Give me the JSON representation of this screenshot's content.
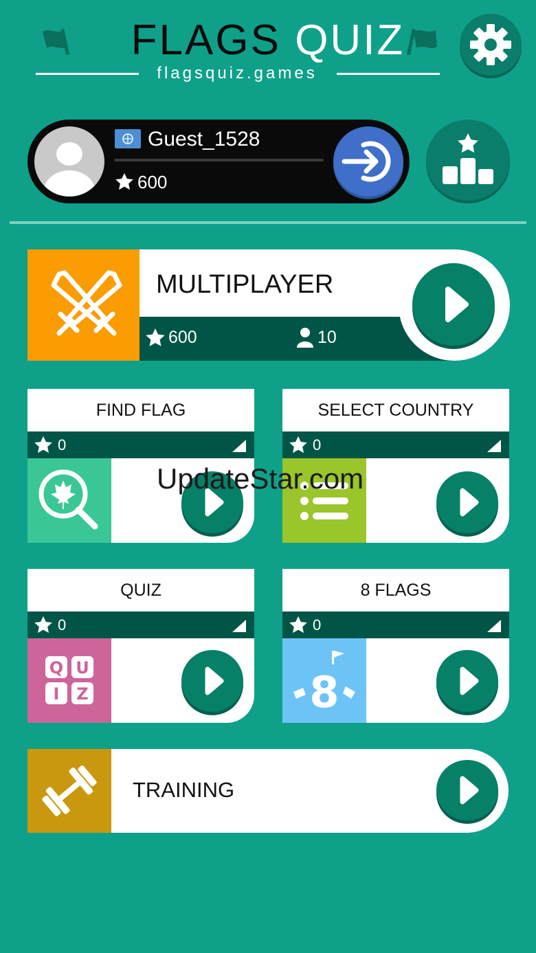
{
  "header": {
    "title_part1": "FLAGS",
    "title_part2": "QUIZ",
    "subtitle": "flagsquiz.games"
  },
  "user": {
    "name": "Guest_1528",
    "points": "600"
  },
  "multiplayer": {
    "title": "MULTIPLAYER",
    "points": "600",
    "players": "10"
  },
  "modes": [
    {
      "title": "FIND FLAG",
      "score": "0",
      "color": "#3ac795"
    },
    {
      "title": "SELECT COUNTRY",
      "score": "0",
      "color": "#9ac52b"
    },
    {
      "title": "QUIZ",
      "score": "0",
      "color": "#cd649a"
    },
    {
      "title": "8 FLAGS",
      "score": "0",
      "color": "#6ec3f6"
    }
  ],
  "quiz_icon_letters": [
    "Q",
    "U",
    "I",
    "Z"
  ],
  "eight_flags_icon_digit": "8",
  "training": {
    "title": "TRAINING"
  },
  "watermark": "UpdateStar.com",
  "colors": {
    "background": "#0fa08a",
    "dark_teal": "#015546",
    "play_button": "#078068",
    "multiplayer_orange": "#fb9c03",
    "training_gold": "#c9980e",
    "login_blue": "#3f6fc8"
  }
}
